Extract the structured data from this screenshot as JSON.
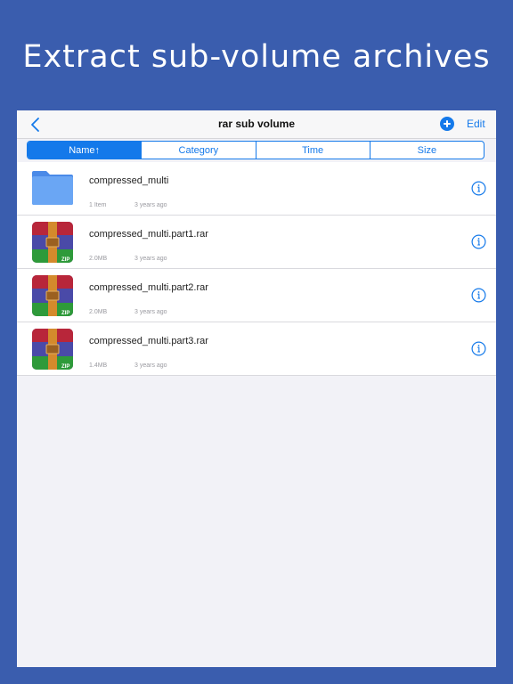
{
  "headline": "Extract sub-volume archives",
  "navbar": {
    "title": "rar sub volume",
    "back_icon": "chevron-left-icon",
    "add_icon": "plus-circle-icon",
    "edit_label": "Edit"
  },
  "sort_tabs": [
    {
      "label": "Name↑",
      "active": true
    },
    {
      "label": "Category",
      "active": false
    },
    {
      "label": "Time",
      "active": false
    },
    {
      "label": "Size",
      "active": false
    }
  ],
  "files": [
    {
      "name": "compressed_multi",
      "kind": "folder",
      "icon": "folder-icon",
      "size": "1 Item",
      "time": "3 years ago"
    },
    {
      "name": "compressed_multi.part1.rar",
      "kind": "archive",
      "icon": "rar-archive-icon",
      "size": "2.0MB",
      "time": "3 years ago"
    },
    {
      "name": "compressed_multi.part2.rar",
      "kind": "archive",
      "icon": "rar-archive-icon",
      "size": "2.0MB",
      "time": "3 years ago"
    },
    {
      "name": "compressed_multi.part3.rar",
      "kind": "archive",
      "icon": "rar-archive-icon",
      "size": "1.4MB",
      "time": "3 years ago"
    }
  ],
  "archive_badge": "ZIP",
  "colors": {
    "background": "#3a5dae",
    "accent": "#1479ea",
    "folder": "#5b9cf2"
  }
}
